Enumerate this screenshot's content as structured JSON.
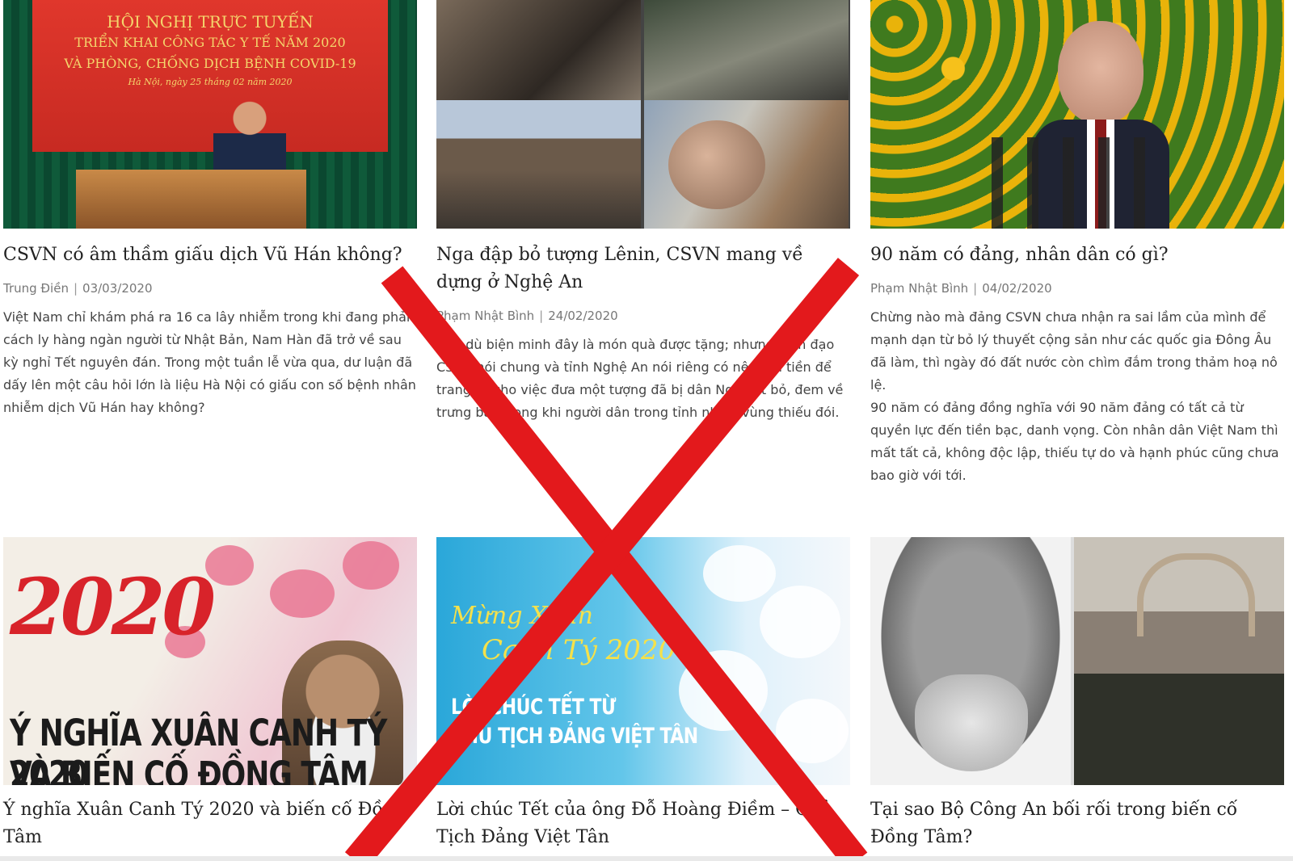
{
  "articles": [
    {
      "title": "CSVN có âm thầm giấu dịch Vũ Hán không?",
      "author": "Trung Điền",
      "date": "03/03/2020",
      "excerpt": [
        "Việt Nam chỉ khám phá ra 16 ca lây nhiễm trong khi đang phải cách ly hàng ngàn người từ Nhật Bản, Nam Hàn đã trở về sau kỳ nghỉ Tết nguyên đán. Trong một tuần lễ vừa qua, dư luận đã dấy lên một câu hỏi lớn là liệu Hà Nội có giấu con số bệnh nhân nhiễm dịch Vũ Hán hay không?"
      ],
      "image_text": {
        "line1": "HỘI NGHỊ TRỰC TUYẾN",
        "line2": "TRIỂN KHAI CÔNG TÁC Y TẾ NĂM 2020",
        "line3": "VÀ PHÒNG, CHỐNG DỊCH BỆNH COVID-19",
        "line4": "Hà Nội, ngày 25 tháng 02 năm 2020"
      }
    },
    {
      "title": "Nga đập bỏ tượng Lênin, CSVN mang về dựng ở Nghệ An",
      "author": "Phạm Nhật Bình",
      "date": "24/02/2020",
      "excerpt": [
        "Cho dù biện minh đây là món quà được tặng; nhưng lãnh đạo CSVN nói chung và tỉnh Nghệ An nói riêng có nên tốn tiền để trang trí cho việc đưa một tượng đã bị dân Nga vứt bỏ, đem về trưng bày trong khi người dân trong tỉnh nhiều vùng thiếu đói."
      ]
    },
    {
      "title": "90 năm có đảng, nhân dân có gì?",
      "author": "Phạm Nhật Bình",
      "date": "04/02/2020",
      "excerpt": [
        "Chừng nào mà đảng CSVN chưa nhận ra sai lầm của mình để mạnh dạn từ bỏ lý thuyết cộng sản như các quốc gia Đông Âu đã làm, thì ngày đó đất nước còn chìm đắm trong thảm hoạ nô lệ.",
        "90 năm có đảng đồng nghĩa với 90 năm đảng có tất cả từ quyền lực đến tiền bạc, danh vọng. Còn nhân dân Việt Nam thì mất tất cả, không độc lập, thiếu tự do và hạnh phúc cũng chưa bao giờ với tới."
      ]
    },
    {
      "title": "Ý nghĩa Xuân Canh Tý 2020 và biến cố Đồng Tâm",
      "image_text": {
        "year": "2020",
        "cap1": "Ý NGHĨA XUÂN CANH TÝ 2020",
        "cap2": "VÀ BIẾN CỐ ĐỒNG TÂM"
      }
    },
    {
      "title": "Lời chúc Tết của ông Đỗ Hoàng Điềm – Chủ Tịch Đảng Việt Tân",
      "image_text": {
        "script1": "Mừng Xuân",
        "script2": "Canh Tý 2020",
        "wish1": "LỜI CHÚC TẾT TỪ",
        "wish2": "CHỦ TỊCH ĐẢNG VIỆT TÂN"
      }
    },
    {
      "title": "Tại sao Bộ Công An bối rối trong biến cố Đồng Tâm?"
    }
  ],
  "meta_separator": "|",
  "overlay": {
    "type": "red-x-mark",
    "color": "#e3191c"
  }
}
